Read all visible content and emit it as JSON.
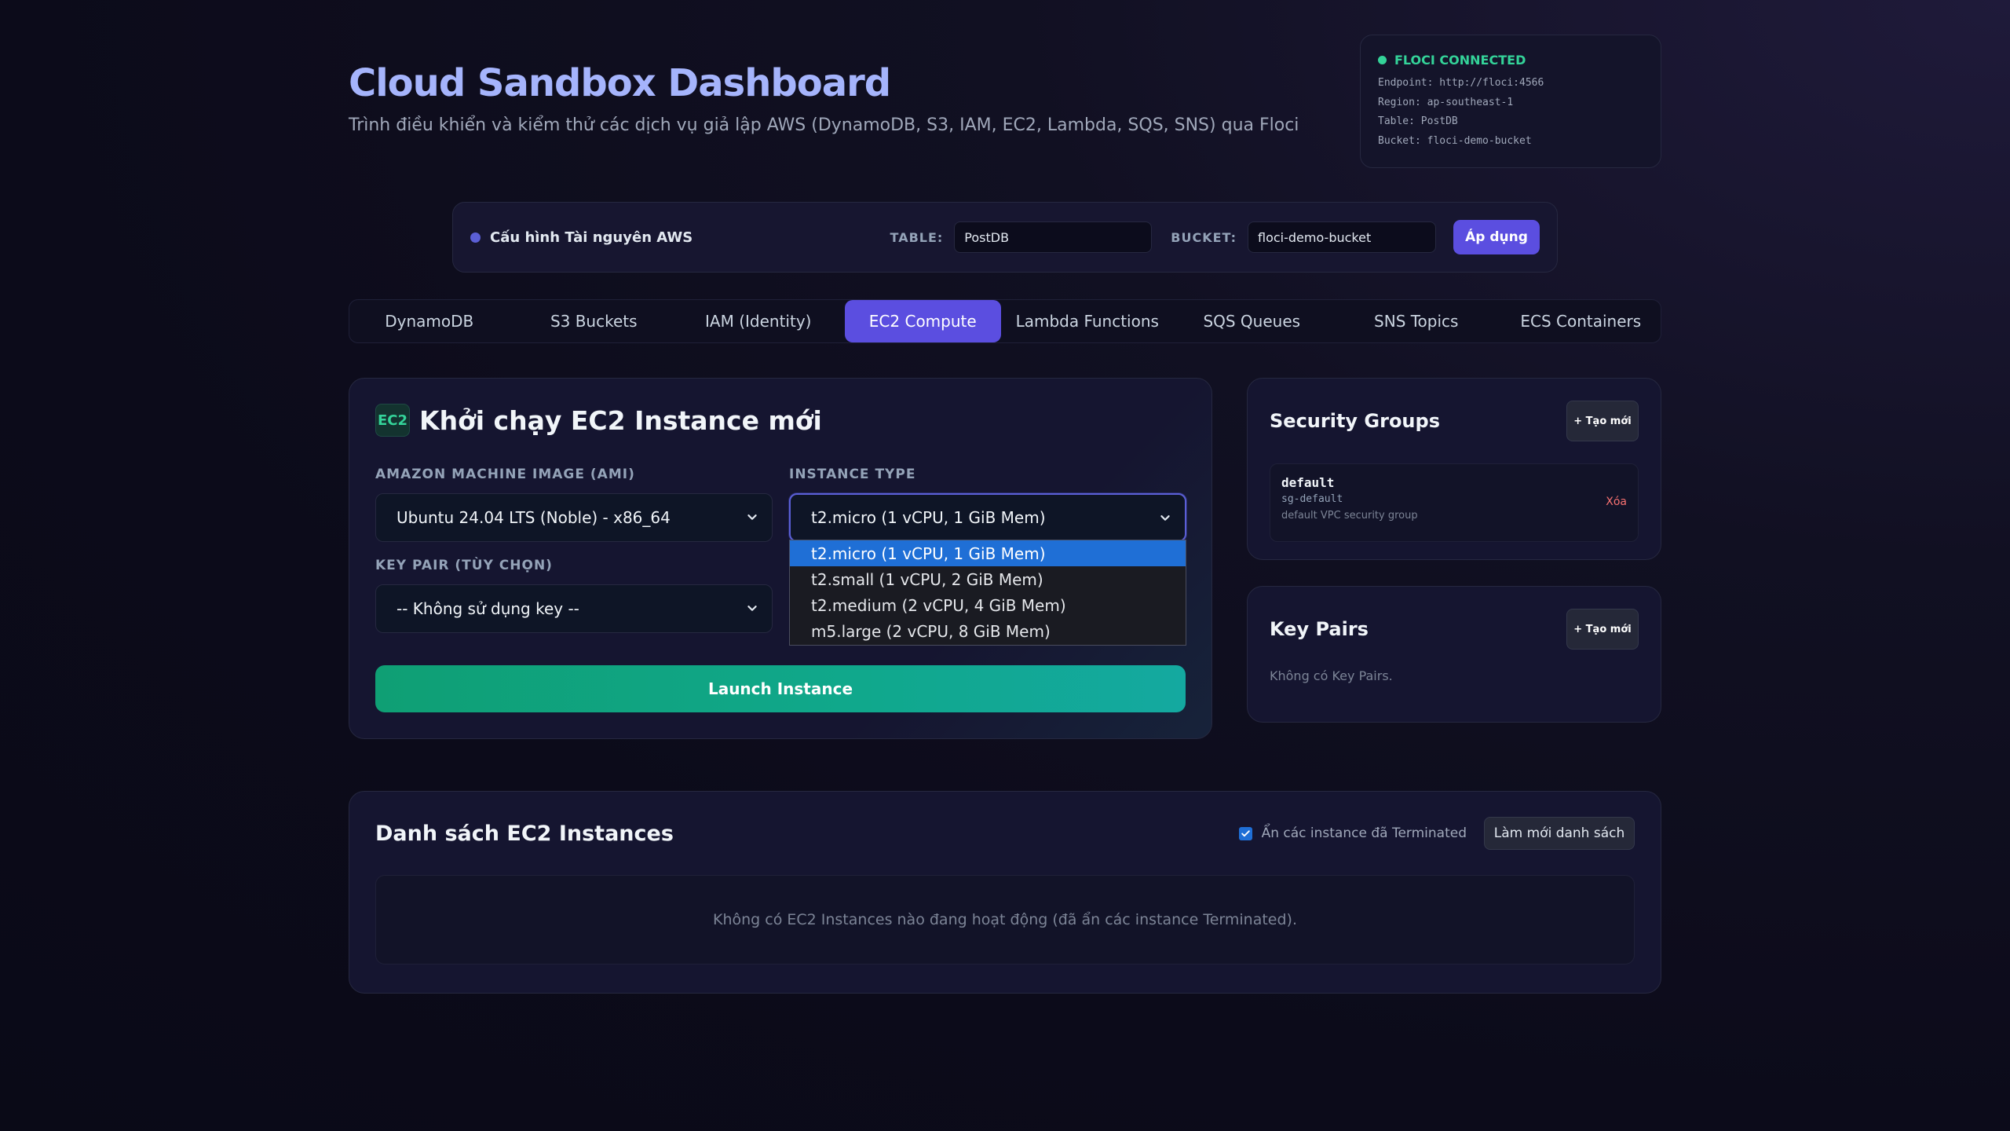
{
  "header": {
    "title": "Cloud Sandbox Dashboard",
    "subtitle": "Trình điều khiển và kiểm thử các dịch vụ giả lập AWS (DynamoDB, S3, IAM, EC2, Lambda, SQS, SNS) qua Floci"
  },
  "status": {
    "label": "FLOCI CONNECTED",
    "lines": [
      "Endpoint: http://floci:4566",
      "Region: ap-southeast-1",
      "Table: PostDB",
      "Bucket: floci-demo-bucket"
    ],
    "color": "#34d399"
  },
  "config": {
    "title": "Cấu hình Tài nguyên AWS",
    "table_label": "TABLE:",
    "table_value": "PostDB",
    "bucket_label": "BUCKET:",
    "bucket_value": "floci-demo-bucket",
    "apply_label": "Áp dụng"
  },
  "tabs": [
    {
      "label": "DynamoDB",
      "active": false
    },
    {
      "label": "S3 Buckets",
      "active": false
    },
    {
      "label": "IAM (Identity)",
      "active": false
    },
    {
      "label": "EC2 Compute",
      "active": true
    },
    {
      "label": "Lambda Functions",
      "active": false
    },
    {
      "label": "SQS Queues",
      "active": false
    },
    {
      "label": "SNS Topics",
      "active": false
    },
    {
      "label": "ECS Containers",
      "active": false
    }
  ],
  "launch": {
    "badge": "EC2",
    "title": "Khởi chạy EC2 Instance mới",
    "ami_label": "AMAZON MACHINE IMAGE (AMI)",
    "ami_value": "Ubuntu 24.04 LTS (Noble) - x86_64",
    "type_label": "INSTANCE TYPE",
    "type_value": "t2.micro (1 vCPU, 1 GiB Mem)",
    "type_options": [
      "t2.micro (1 vCPU, 1 GiB Mem)",
      "t2.small (1 vCPU, 2 GiB Mem)",
      "t2.medium (2 vCPU, 4 GiB Mem)",
      "m5.large (2 vCPU, 8 GiB Mem)"
    ],
    "keypair_label": "KEY PAIR (TÙY CHỌN)",
    "keypair_value": "-- Không sử dụng key --",
    "launch_button": "Launch Instance"
  },
  "security_groups": {
    "title": "Security Groups",
    "new_button": "+ Tạo mới",
    "items": [
      {
        "name": "default",
        "id": "sg-default",
        "description": "default VPC security group",
        "delete_label": "Xóa"
      }
    ]
  },
  "key_pairs": {
    "title": "Key Pairs",
    "new_button": "+ Tạo mới",
    "empty": "Không có Key Pairs."
  },
  "instances": {
    "title": "Danh sách EC2 Instances",
    "hide_terminated_label": "Ẩn các instance đã Terminated",
    "hide_terminated_checked": true,
    "refresh_button": "Làm mới danh sách",
    "empty": "Không có EC2 Instances nào đang hoạt động (đã ẩn các instance Terminated)."
  }
}
